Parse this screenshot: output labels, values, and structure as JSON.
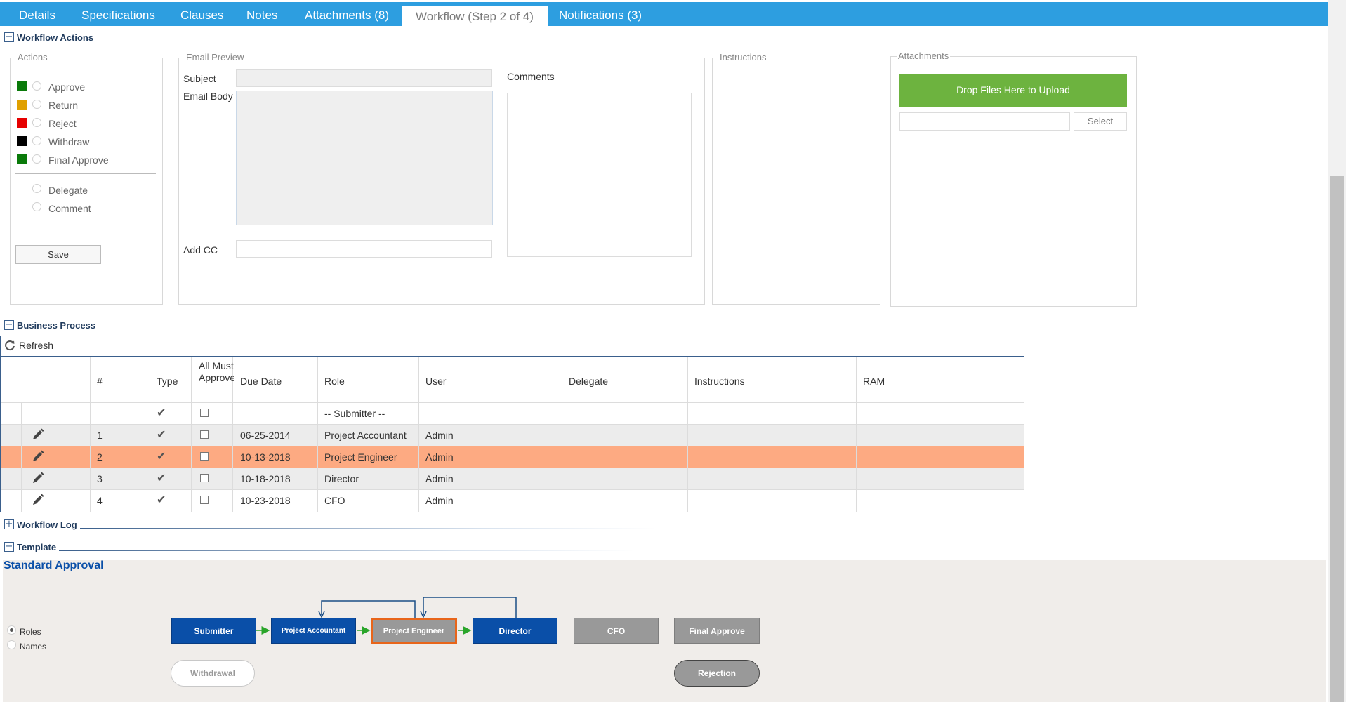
{
  "tabs": [
    {
      "label": "Details"
    },
    {
      "label": "Specifications"
    },
    {
      "label": "Clauses"
    },
    {
      "label": "Notes"
    },
    {
      "label": "Attachments (8)"
    },
    {
      "label": "Workflow (Step 2 of 4)"
    },
    {
      "label": "Notifications (3)"
    }
  ],
  "sections": {
    "workflow_actions": "Workflow Actions",
    "business_process": "Business Process",
    "workflow_log": "Workflow Log",
    "template": "Template"
  },
  "actions": {
    "legend": "Actions",
    "options": [
      {
        "label": "Approve",
        "color": "#0a7a0a"
      },
      {
        "label": "Return",
        "color": "#e0a000"
      },
      {
        "label": "Reject",
        "color": "#e60000"
      },
      {
        "label": "Withdraw",
        "color": "#000000"
      },
      {
        "label": "Final Approve",
        "color": "#0a7a0a"
      }
    ],
    "extra_options": [
      {
        "label": "Delegate"
      },
      {
        "label": "Comment"
      }
    ],
    "save_label": "Save"
  },
  "email_preview": {
    "legend": "Email Preview",
    "subject_label": "Subject",
    "body_label": "Email Body",
    "cc_label": "Add CC",
    "comments_label": "Comments"
  },
  "instructions": {
    "legend": "Instructions"
  },
  "attachments": {
    "legend": "Attachments",
    "drop_label": "Drop Files Here to Upload",
    "select_label": "Select"
  },
  "business_process": {
    "refresh_label": "Refresh",
    "columns": [
      "#",
      "Type",
      "All Must Approve",
      "Due Date",
      "Role",
      "User",
      "Delegate",
      "Instructions",
      "RAM"
    ],
    "rows": [
      {
        "num": "",
        "due": "",
        "role": "-- Submitter --",
        "user": "",
        "editable": false,
        "highlight": false
      },
      {
        "num": "1",
        "due": "06-25-2014",
        "role": "Project Accountant",
        "user": "Admin",
        "editable": true,
        "highlight": false
      },
      {
        "num": "2",
        "due": "10-13-2018",
        "role": "Project Engineer",
        "user": "Admin",
        "editable": true,
        "highlight": true
      },
      {
        "num": "3",
        "due": "10-18-2018",
        "role": "Director",
        "user": "Admin",
        "editable": true,
        "highlight": false
      },
      {
        "num": "4",
        "due": "10-23-2018",
        "role": "CFO",
        "user": "Admin",
        "editable": true,
        "highlight": false
      }
    ],
    "highlight_color": "#fdaa82",
    "alt_row_color": "#ececec"
  },
  "template": {
    "name": "Standard Approval",
    "view_options": [
      {
        "label": "Roles",
        "checked": true
      },
      {
        "label": "Names",
        "checked": false
      }
    ],
    "nodes": [
      {
        "label": "Submitter",
        "state": "done"
      },
      {
        "label": "Project Accountant",
        "state": "done"
      },
      {
        "label": "Project Engineer",
        "state": "current"
      },
      {
        "label": "Director",
        "state": "done"
      },
      {
        "label": "CFO",
        "state": "pending"
      },
      {
        "label": "Final Approve",
        "state": "pending"
      }
    ],
    "withdrawal_label": "Withdrawal",
    "rejection_label": "Rejection"
  },
  "colors": {
    "tab_bar": "#2d9ee0",
    "drop_zone": "#6db33f",
    "node_blue": "#0a4fa8",
    "node_gray": "#999999",
    "current_border": "#e8651a",
    "arrow_green": "#2aa52a",
    "return_arrow": "#1a4e86"
  }
}
